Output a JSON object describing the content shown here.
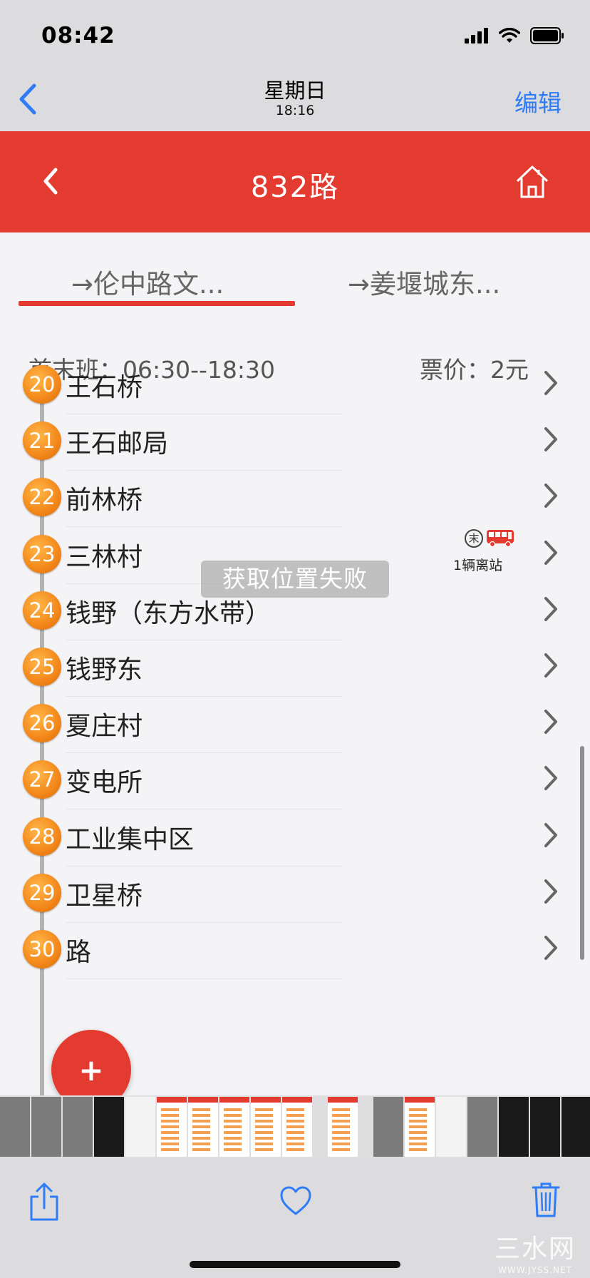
{
  "status_bar": {
    "time": "08:42",
    "icons": [
      "signal-icon",
      "wifi-icon",
      "battery-icon"
    ]
  },
  "photos_nav": {
    "back_icon": "chevron-left-icon",
    "title": "星期日",
    "subtitle": "18:16",
    "edit_label": "编辑"
  },
  "app_header": {
    "back_icon": "chevron-left-icon",
    "title": "832路",
    "home_icon": "home-icon",
    "bg_color": "#e33b30"
  },
  "direction_tabs": [
    {
      "label": "→伦中路文...",
      "active": true
    },
    {
      "label": "→姜堰城东...",
      "active": false
    }
  ],
  "schedule": {
    "first_last": "首末班：06:30--18:30",
    "price": "票价：2元"
  },
  "stops": [
    {
      "num": "20",
      "name": "王石桥"
    },
    {
      "num": "21",
      "name": "王石邮局"
    },
    {
      "num": "22",
      "name": "前林桥"
    },
    {
      "num": "23",
      "name": "三林村",
      "bus": {
        "end_label": "末",
        "text": "1辆离站"
      }
    },
    {
      "num": "24",
      "name": "钱野（东方水带）"
    },
    {
      "num": "25",
      "name": "钱野东"
    },
    {
      "num": "26",
      "name": "夏庄村"
    },
    {
      "num": "27",
      "name": "变电所"
    },
    {
      "num": "28",
      "name": "工业集中区"
    },
    {
      "num": "29",
      "name": "卫星桥"
    },
    {
      "num": "30",
      "name": "路"
    }
  ],
  "toast": "获取位置失败",
  "fab_label": "+",
  "toolbar": {
    "icons": [
      "share-icon",
      "heart-icon",
      "trash-icon"
    ]
  },
  "watermark": {
    "text": "三水网",
    "url": "WWW.JYSS.NET"
  }
}
